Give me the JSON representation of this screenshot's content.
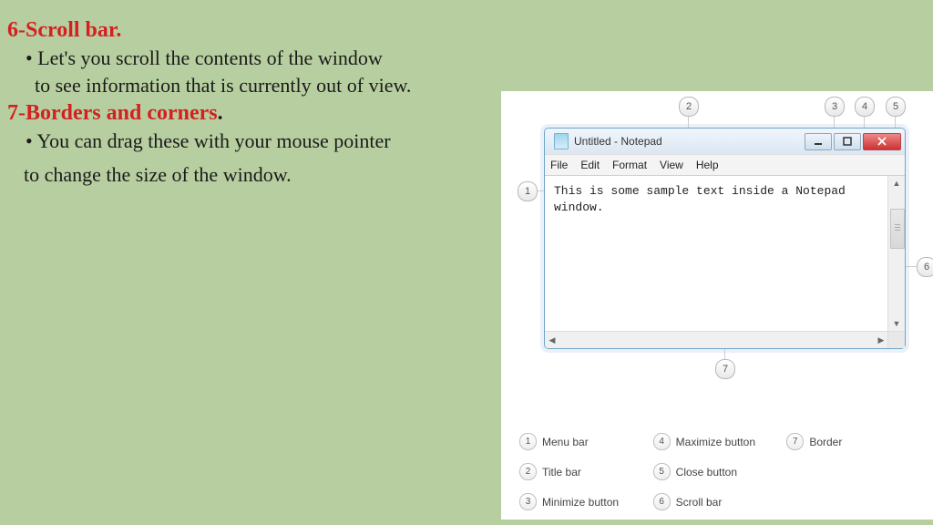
{
  "section6": {
    "heading": "6-Scroll bar.",
    "line1": "•  Let's you scroll the contents of the window",
    "line2": "to see information that is currently out of view."
  },
  "section7": {
    "heading_span1": "7-Borders and corners",
    "heading_span2": ".",
    "line1": "• You can drag these with your mouse pointer",
    "line2": "to change the size of the window."
  },
  "notepad": {
    "title": "Untitled - Notepad",
    "menu": [
      "File",
      "Edit",
      "Format",
      "View",
      "Help"
    ],
    "body": "This is some sample text inside a Notepad window."
  },
  "callouts": {
    "c1": "1",
    "c2": "2",
    "c3": "3",
    "c4": "4",
    "c5": "5",
    "c6": "6",
    "c7": "7"
  },
  "legend": [
    {
      "num": "1",
      "label": "Menu bar"
    },
    {
      "num": "4",
      "label": "Maximize button"
    },
    {
      "num": "7",
      "label": "Border"
    },
    {
      "num": "2",
      "label": "Title bar"
    },
    {
      "num": "5",
      "label": "Close button"
    },
    {
      "num": "",
      "label": ""
    },
    {
      "num": "3",
      "label": "Minimize button"
    },
    {
      "num": "6",
      "label": "Scroll bar"
    }
  ]
}
